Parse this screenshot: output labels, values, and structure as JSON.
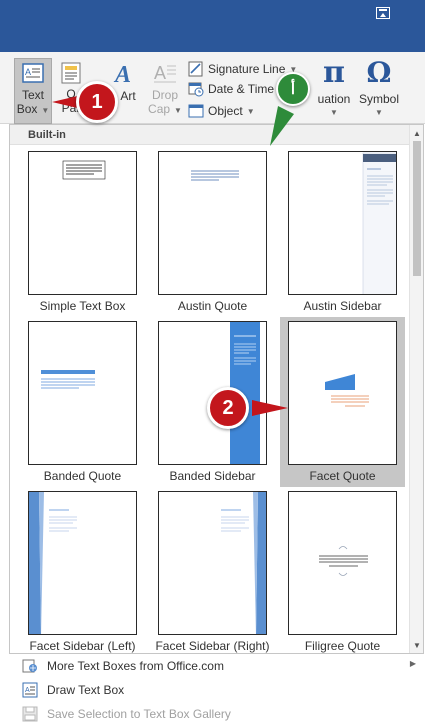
{
  "colors": {
    "titlebar": "#2b579a",
    "badge_red": "#c3161c",
    "badge_green": "#2e8b3a",
    "accent_blue": "#4472c4"
  },
  "ribbon": {
    "text_box": {
      "line1": "Text",
      "line2": "Box"
    },
    "quick_parts": {
      "line1": "Q",
      "line2": "Par"
    },
    "wordart": {
      "label": "Art"
    },
    "drop_cap": {
      "line1": "Drop",
      "line2": "Cap"
    },
    "signature_line": "Signature Line",
    "date_time": "Date & Time",
    "object": "Object",
    "equation": "uation",
    "symbol": "Symbol"
  },
  "gallery": {
    "header": "Built-in",
    "items": [
      {
        "label": "Simple Text Box"
      },
      {
        "label": "Austin Quote"
      },
      {
        "label": "Austin Sidebar"
      },
      {
        "label": "Banded Quote"
      },
      {
        "label": "Banded Sidebar"
      },
      {
        "label": "Facet Quote"
      },
      {
        "label": "Facet Sidebar (Left)"
      },
      {
        "label": "Facet Sidebar (Right)"
      },
      {
        "label": "Filigree Quote"
      }
    ]
  },
  "menu": {
    "more": "More Text Boxes from Office.com",
    "draw": "Draw Text Box",
    "save": "Save Selection to Text Box Gallery"
  },
  "annotations": {
    "badge1": "1",
    "badge2": "2",
    "badge_alt": "أ"
  }
}
